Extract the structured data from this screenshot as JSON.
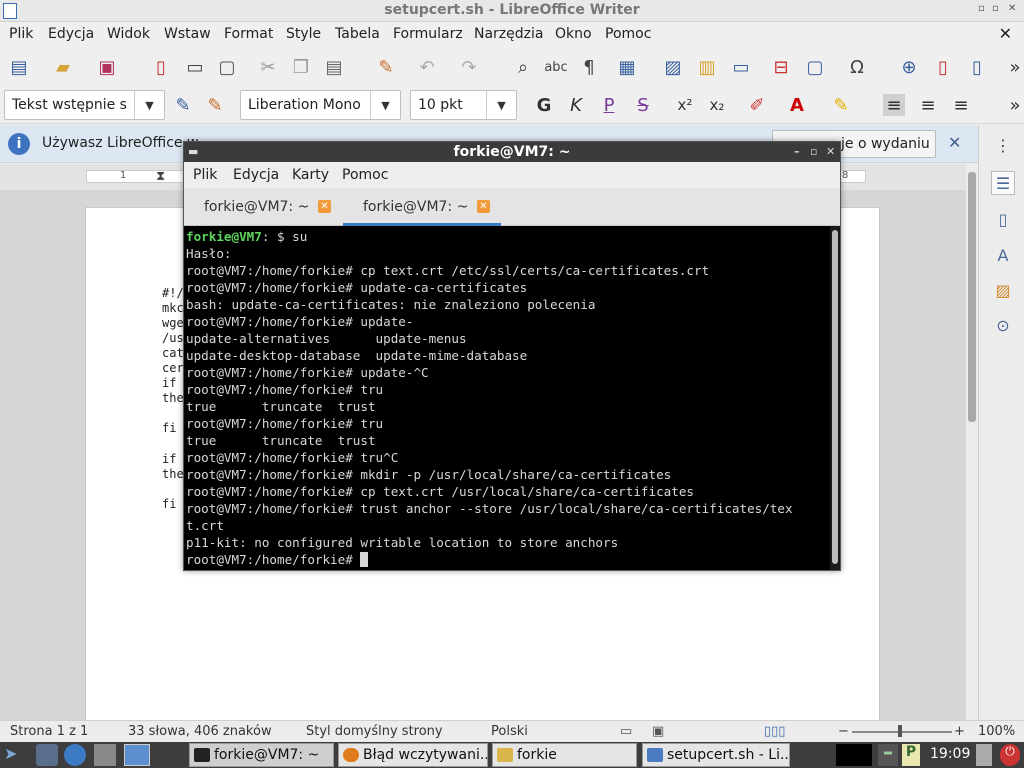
{
  "window": {
    "title": "setupcert.sh - LibreOffice Writer",
    "controls": [
      "▫",
      "▫",
      "✕"
    ]
  },
  "menubar": [
    "Plik",
    "Edycja",
    "Widok",
    "Wstaw",
    "Format",
    "Style",
    "Tabela",
    "Formularz",
    "Narzędzia",
    "Okno",
    "Pomoc"
  ],
  "menubar_close": "✕",
  "formatting": {
    "para_style": "Tekst wstępnie s",
    "font_name": "Liberation Mono",
    "font_size": "10 pkt",
    "bold": "G",
    "italic": "K",
    "underline": "P",
    "strike": "S",
    "superscript": "x²",
    "subscript": "x₂"
  },
  "infobar": {
    "message": "Używasz LibreOffice w",
    "message_tail": "",
    "button": "je o wydaniu",
    "close": "✕"
  },
  "ruler": {
    "marks": [
      "1",
      "8"
    ]
  },
  "document": {
    "lines": [
      "#!/",
      "mkc",
      "wge",
      "/us",
      "cat",
      "cer",
      "if ",
      "the",
      "fi",
      "if ",
      "the",
      "fi"
    ]
  },
  "statusbar": {
    "page": "Strona 1 z 1",
    "words": "33 słowa, 406 znaków",
    "page_style": "Styl domyślny strony",
    "language": "Polski",
    "zoom": "100%"
  },
  "terminal": {
    "title": "forkie@VM7: ~",
    "menu": [
      "Plik",
      "Edycja",
      "Karty",
      "Pomoc"
    ],
    "tabs": [
      {
        "label": "forkie@VM7: ~",
        "selected": false
      },
      {
        "label": "forkie@VM7: ~",
        "selected": true
      }
    ],
    "first_prompt_user": "forkie@VM7",
    "first_prompt_rest": ": $ su",
    "lines": [
      "Hasło:",
      "root@VM7:/home/forkie# cp text.crt /etc/ssl/certs/ca-certificates.crt",
      "root@VM7:/home/forkie# update-ca-certificates",
      "bash: update-ca-certificates: nie znaleziono polecenia",
      "root@VM7:/home/forkie# update-",
      "update-alternatives      update-menus",
      "update-desktop-database  update-mime-database",
      "root@VM7:/home/forkie# update-^C",
      "root@VM7:/home/forkie# tru",
      "true      truncate  trust",
      "root@VM7:/home/forkie# tru",
      "true      truncate  trust",
      "root@VM7:/home/forkie# tru^C",
      "root@VM7:/home/forkie# mkdir -p /usr/local/share/ca-certificates",
      "root@VM7:/home/forkie# cp text.crt /usr/local/share/ca-certificates",
      "root@VM7:/home/forkie# trust anchor --store /usr/local/share/ca-certificates/tex",
      "t.crt",
      "p11-kit: no configured writable location to store anchors"
    ],
    "last_prompt": "root@VM7:/home/forkie# "
  },
  "taskbar": {
    "tasks": [
      "forkie@VM7: ~",
      "Błąd wczytywani...",
      "forkie",
      "setupcert.sh - Li..."
    ],
    "clock": "19:09"
  }
}
